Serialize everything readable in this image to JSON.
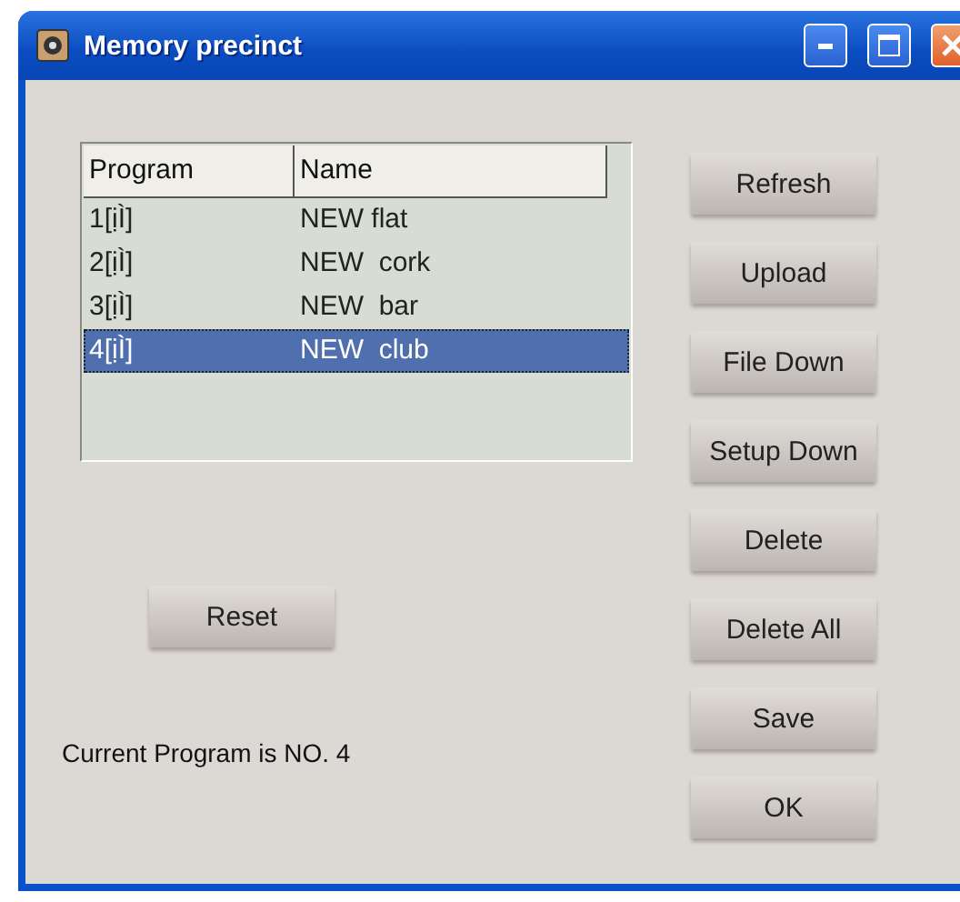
{
  "window": {
    "title": "Memory precinct"
  },
  "table": {
    "columns": [
      "Program",
      "Name"
    ],
    "rows": [
      {
        "program": "1[ịÌ]",
        "name": "NEW flat",
        "selected": false
      },
      {
        "program": "2[ịÌ]",
        "name": "NEW  cork",
        "selected": false
      },
      {
        "program": "3[ịÌ]",
        "name": "NEW  bar",
        "selected": false
      },
      {
        "program": "4[ịÌ]",
        "name": "NEW  club",
        "selected": true
      }
    ]
  },
  "reset_button": "Reset",
  "buttons": [
    "Refresh",
    "Upload",
    "File Down",
    "Setup Down",
    "Delete",
    "Delete All",
    "Save",
    "OK"
  ],
  "status": "Current Program is NO. 4"
}
